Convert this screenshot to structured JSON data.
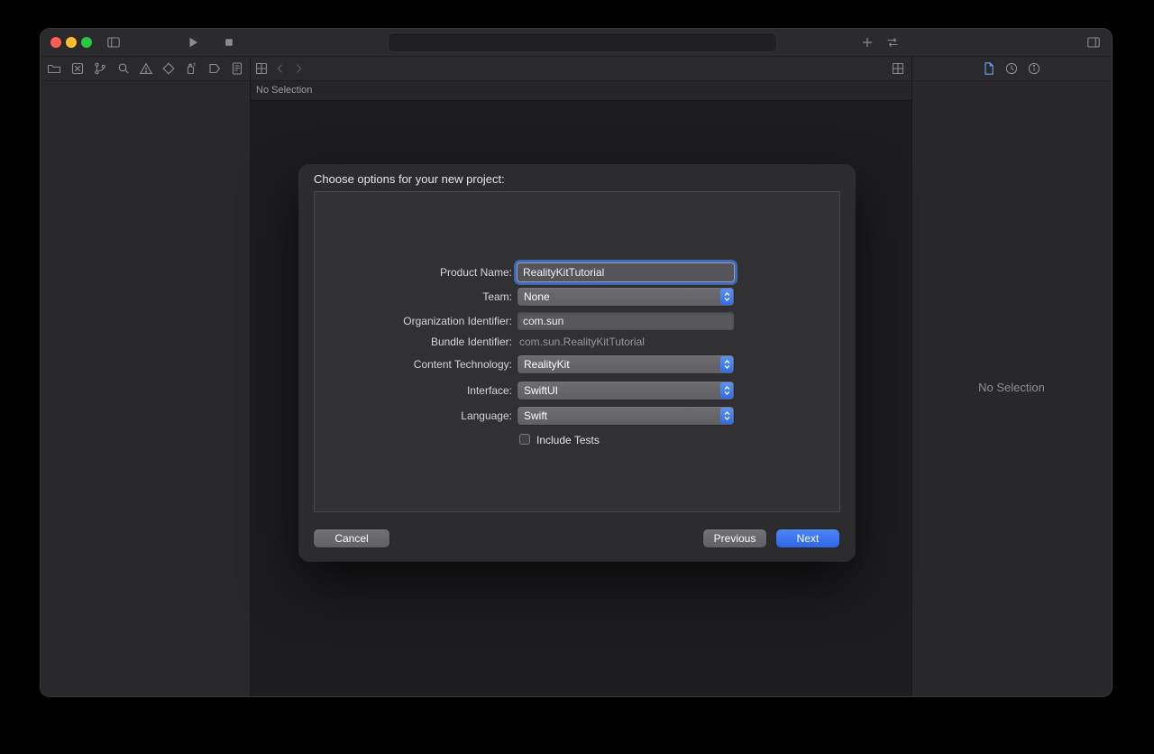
{
  "window": {
    "title_bar": {
      "traffic_lights": [
        "close",
        "minimize",
        "zoom"
      ],
      "icons": [
        "sidebar-toggle",
        "run",
        "stop",
        "add",
        "route",
        "inspector-toggle"
      ]
    },
    "navigator_tabs": [
      "project",
      "x-square",
      "source-control-branch",
      "find-magnifier",
      "issues-warning",
      "tests-diamond",
      "debug-spray",
      "breakpoints-tag",
      "reports-doc"
    ],
    "editor": {
      "jump_bar_text": "No Selection"
    },
    "inspector": {
      "tabs": [
        "file",
        "history",
        "help"
      ],
      "placeholder": "No Selection"
    }
  },
  "sheet": {
    "title": "Choose options for your new project:",
    "rows": [
      {
        "label": "Product Name:",
        "value": "RealityKitTutorial",
        "type": "textfield",
        "focused": true
      },
      {
        "label": "Team:",
        "value": "None",
        "type": "popup"
      },
      {
        "label": "Organization Identifier:",
        "value": "com.sun",
        "type": "textfield"
      },
      {
        "label": "Bundle Identifier:",
        "value": "com.sun.RealityKitTutorial",
        "type": "static"
      },
      {
        "label": "Content Technology:",
        "value": "RealityKit",
        "type": "popup"
      },
      {
        "label": "Interface:",
        "value": "SwiftUI",
        "type": "popup"
      },
      {
        "label": "Language:",
        "value": "Swift",
        "type": "popup"
      },
      {
        "label": "Include Tests",
        "type": "checkbox",
        "checked": false
      }
    ],
    "buttons": {
      "cancel": "Cancel",
      "previous": "Previous",
      "next": "Next"
    }
  },
  "colors": {
    "accent": "#3a78f2",
    "window_bg": "#232326",
    "sheet_bg": "#2c2c2f",
    "next_button": "#2f67e8"
  }
}
